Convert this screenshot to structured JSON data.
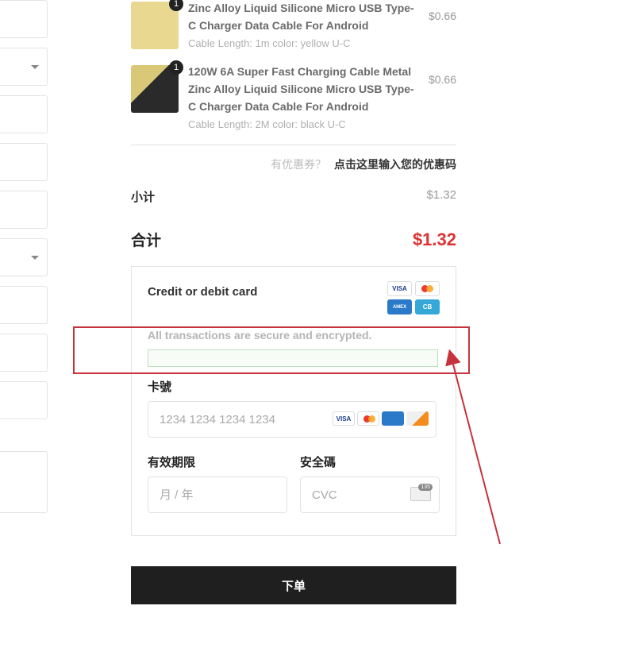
{
  "products": [
    {
      "title": "Zinc Alloy Liquid Silicone Micro USB Type-C Charger Data Cable For Android",
      "sub": "Cable Length: 1m color: yellow U-C",
      "price": "$0.66",
      "qty": "1"
    },
    {
      "title": "120W 6A Super Fast Charging Cable Metal Zinc Alloy Liquid Silicone Micro USB Type-C Charger Data Cable For Android",
      "sub": "Cable Length: 2M color: black U-C",
      "price": "$0.66",
      "qty": "1"
    }
  ],
  "coupon": {
    "question": "有优惠券？",
    "link": "点击这里输入您的优惠码"
  },
  "subtotal": {
    "label": "小计",
    "amount": "$1.32"
  },
  "total": {
    "label": "合计",
    "amount": "$1.32"
  },
  "payment": {
    "title": "Credit or debit card",
    "secure_note": "All transactions are secure and encrypted.",
    "card_label": "卡號",
    "card_placeholder": "1234 1234 1234 1234",
    "expiry_label": "有效期限",
    "expiry_placeholder": "月 / 年",
    "cvc_label": "安全碼",
    "cvc_placeholder": "CVC"
  },
  "submit_label": "下单",
  "card_brands": {
    "visa": "VISA",
    "amex": "AMEX",
    "cb": "CB",
    "discover": "DISCOVER"
  }
}
